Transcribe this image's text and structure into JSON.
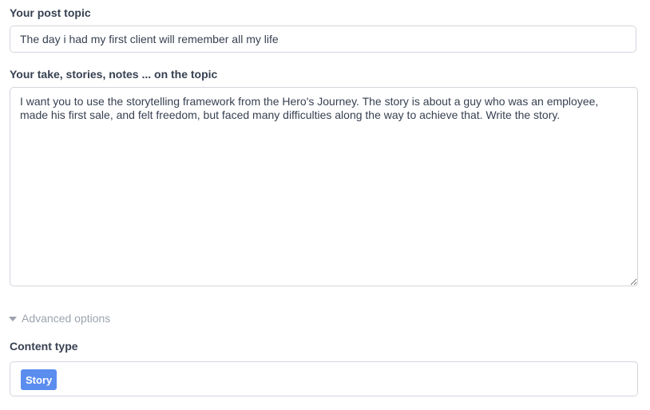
{
  "post_topic": {
    "label": "Your post topic",
    "value": "The day i had my first client will remember all my life"
  },
  "take": {
    "label": "Your take, stories, notes ... on the topic",
    "value": "I want you to use the storytelling framework from the Hero's Journey. The story is about a guy who was an employee, made his first sale, and felt freedom, but faced many difficulties along the way to achieve that. Write the story."
  },
  "advanced_options": {
    "label": "Advanced options",
    "icon": "caret-down-icon"
  },
  "content_type": {
    "label": "Content type",
    "selected": "Story"
  },
  "colors": {
    "chip": "#5b8def",
    "border": "#d1d5db",
    "muted": "#9ca3af"
  }
}
